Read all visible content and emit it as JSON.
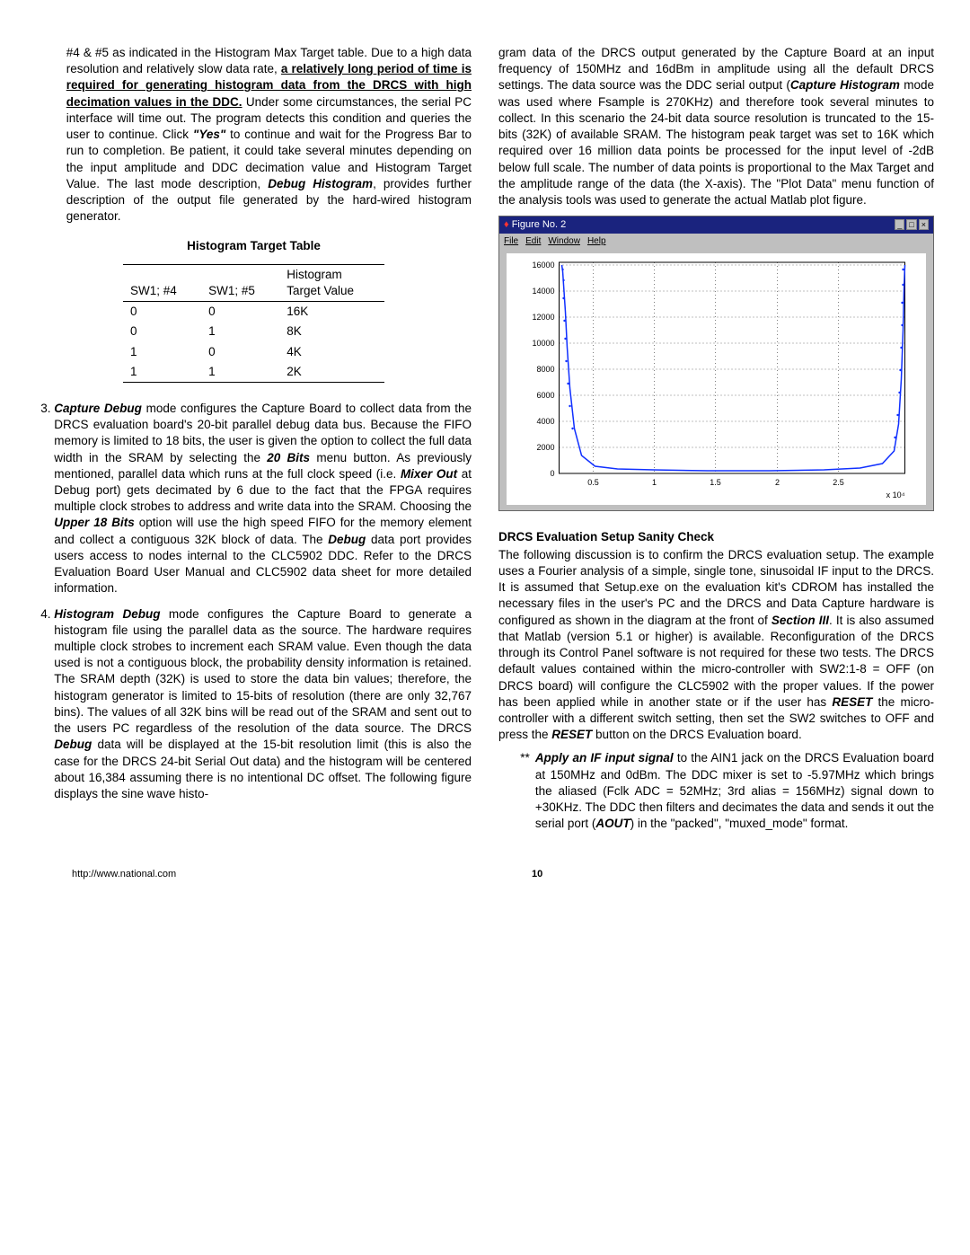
{
  "left": {
    "p1_a": "#4 & #5 as indicated in the Histogram Max Target table. Due to a high data resolution and relatively slow data rate, ",
    "p1_u": "a relatively long period of time is required for generating histogram data from the DRCS with high decimation values in the DDC.",
    "p1_b": " Under some circumstances, the serial PC interface will time out. The program detects this condition and queries the user to continue. Click ",
    "p1_yes": "\"Yes\"",
    "p1_c": " to continue and wait for the Progress Bar to run to completion. Be patient, it could take several minutes depending on the input amplitude and DDC decimation value and Histogram Target Value. The last mode description, ",
    "p1_dbg": "Debug Histogram",
    "p1_d": ", provides further description of the output file generated by the hard-wired histogram generator.",
    "table_title": "Histogram Target Table",
    "th1": "SW1; #4",
    "th2": "SW1; #5",
    "th3a": "Histogram",
    "th3b": "Target Value",
    "rows": [
      {
        "a": "0",
        "b": "0",
        "c": "16K"
      },
      {
        "a": "0",
        "b": "1",
        "c": "8K"
      },
      {
        "a": "1",
        "b": "0",
        "c": "4K"
      },
      {
        "a": "1",
        "b": "1",
        "c": "2K"
      }
    ],
    "li3_a": "Capture Debug",
    "li3_b": " mode configures the Capture Board to collect data from the DRCS evaluation board's 20-bit parallel debug data bus. Because the FIFO memory is limited to 18 bits, the user is given the option to collect the full data width in the SRAM by selecting the ",
    "li3_c": "20 Bits",
    "li3_d": " menu button. As previously mentioned, parallel data which runs at the full clock speed (i.e. ",
    "li3_e": "Mixer Out",
    "li3_f": " at Debug port) gets decimated by 6 due to the fact that the FPGA requires multiple clock strobes to address and write data into the SRAM. Choosing the ",
    "li3_g": "Upper 18 Bits",
    "li3_h": " option will use the high speed FIFO for the memory element and collect a contiguous 32K block of data. The ",
    "li3_i": "Debug",
    "li3_j": " data port provides users access to nodes internal to the CLC5902 DDC. Refer to the DRCS Evaluation Board User Manual and CLC5902 data sheet for more detailed information.",
    "li4_a": "Histogram Debug",
    "li4_b": " mode configures the Capture Board to generate a histogram file using the parallel data as the source. The hardware requires multiple clock strobes to increment each SRAM value. Even though the data used is not a contiguous block, the probability density information is retained. The SRAM depth (32K) is used to store the data bin values; therefore, the histogram generator is limited to 15-bits of resolution (there are only 32,767 bins). The values of all 32K bins will be read out of the SRAM and sent out to the users PC regardless of the resolution of the data source. The DRCS ",
    "li4_c": "Debug",
    "li4_d": " data will be displayed at the 15-bit resolution limit (this is also the case for the DRCS 24-bit Serial Out data) and the histogram will be centered about 16,384 assuming there is no intentional DC offset. The following figure displays the sine wave histo-"
  },
  "right": {
    "p1_a": "gram data of the DRCS output generated by the Capture Board at an input frequency of 150MHz and 16dBm in amplitude using all the default DRCS settings. The data source was the DDC serial output (",
    "p1_b": "Capture Histogram",
    "p1_c": " mode was used where Fsample is 270KHz) and therefore took several minutes to collect. In this scenario the 24-bit data source resolution is truncated to the 15-bits (32K) of available SRAM. The histogram peak target was set to 16K which required over 16 million data points be processed for the input level of -2dB below full scale. The number of data points is proportional to the Max Target and the amplitude range of the data (the X-axis). The \"Plot Data\" menu function of the analysis tools was used to generate the actual Matlab plot figure.",
    "fig_title": "Figure No. 2",
    "menu_file": "File",
    "menu_edit": "Edit",
    "menu_win": "Window",
    "menu_help": "Help",
    "sec_head": "DRCS Evaluation Setup Sanity Check",
    "p2_a": "The following discussion is to confirm the DRCS evaluation setup. The example uses a Fourier analysis of a simple, single tone, sinusoidal IF input to the DRCS. It is assumed that Setup.exe on the evaluation kit's CDROM has installed the necessary files in the user's PC and the DRCS and Data Capture hardware is configured as shown in the diagram at the front of ",
    "p2_b": "Section III",
    "p2_c": ". It is also assumed that Matlab (version 5.1 or higher) is available. Reconfiguration of the DRCS through its Control Panel software is not required for these two tests. The DRCS default values contained within the micro-controller with SW2:1-8 = OFF (on DRCS board) will configure the CLC5902 with the proper values. If the power has been applied while in another state or if the user has ",
    "p2_d": "RESET",
    "p2_e": " the micro-controller with a different switch setting, then set the SW2 switches to OFF and press the ",
    "p2_f": "RESET",
    "p2_g": " button on the DRCS Evaluation board.",
    "star_mark": "**",
    "s1_a": "Apply an IF input signal",
    "s1_b": " to the AIN1 jack on the DRCS Evaluation board at 150MHz and 0dBm. The DDC mixer is set to -5.97MHz which brings the aliased (Fclk ADC = 52MHz; 3rd alias = 156MHz) signal down to +30KHz. The DDC then filters and decimates the data and sends it out the serial port (",
    "s1_c": "AOUT",
    "s1_d": ") in the \"packed\", \"muxed_mode\" format."
  },
  "chart_data": {
    "type": "line",
    "title": "",
    "xlabel": "",
    "ylabel": "",
    "x_note": "x 10^4",
    "y_ticks": [
      0,
      2000,
      4000,
      6000,
      8000,
      10000,
      12000,
      14000,
      16000
    ],
    "x_ticks": [
      0.5,
      1,
      1.5,
      2,
      2.5
    ],
    "xlim": [
      0.22,
      3.05
    ],
    "ylim": [
      0,
      16500
    ],
    "description": "Bathtub-shaped histogram: sharp peaks ~16000 at x≈0.25 and x≈3.0, flat minimum ~250–300 across the center.",
    "series": [
      {
        "name": "histogram",
        "x": [
          0.24,
          0.26,
          0.28,
          0.3,
          0.35,
          0.4,
          0.5,
          0.6,
          0.8,
          1.0,
          1.2,
          1.4,
          1.6,
          1.8,
          2.0,
          2.2,
          2.4,
          2.6,
          2.75,
          2.85,
          2.92,
          2.97,
          3.0,
          3.02,
          3.04
        ],
        "y": [
          16000,
          14500,
          12000,
          9000,
          5000,
          2500,
          900,
          500,
          350,
          300,
          280,
          260,
          260,
          270,
          290,
          320,
          400,
          600,
          1200,
          3000,
          6500,
          10500,
          13500,
          15500,
          16000
        ]
      }
    ]
  },
  "footer": {
    "url": "http://www.national.com",
    "page": "10"
  }
}
